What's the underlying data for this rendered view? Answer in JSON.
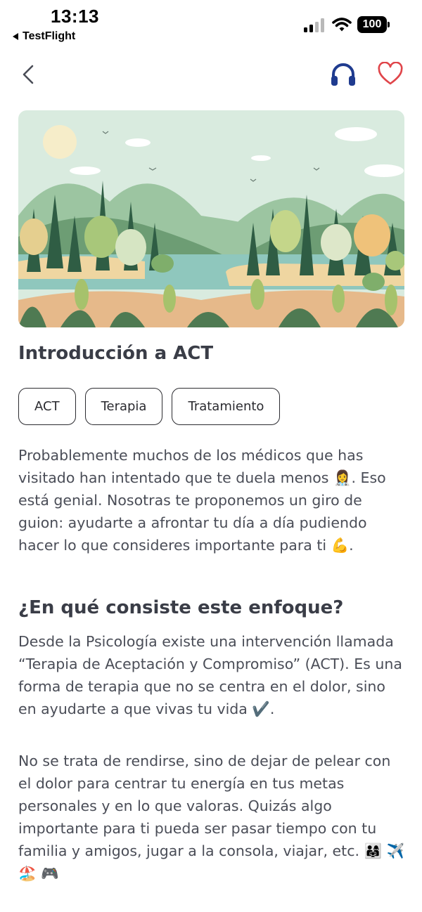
{
  "status_bar": {
    "time": "13:13",
    "back_app": "TestFlight",
    "battery": "100"
  },
  "nav": {
    "back_icon": "chevron-left-icon",
    "audio_icon": "headphones-icon",
    "favorite_icon": "heart-icon"
  },
  "colors": {
    "accent_blue": "#1f3b8f",
    "accent_red": "#e0454a",
    "text_dark": "#3a3d47"
  },
  "article": {
    "title": "Introducción a ACT",
    "tags": [
      "ACT",
      "Terapia",
      "Tratamiento"
    ],
    "intro": "Probablemente muchos de los médicos que has visitado han intentado que te duela menos 👩‍⚕️. Eso está genial. Nosotras te proponemos un giro de guion: ayudarte a afrontar tu día a día pudiendo hacer lo que consideres importante para ti 💪.",
    "section_heading": "¿En qué consiste este enfoque?",
    "section_p1": "Desde la Psicología existe una intervención llamada “Terapia de Aceptación y Compromiso” (ACT). Es una forma de terapia que no se centra en el dolor, sino en ayudarte a que vivas tu vida ✔️.",
    "section_p2": "No se trata de rendirse, sino de dejar de pelear con el dolor para centrar tu energía en tus metas personales y en lo que valoras. Quizás algo importante para ti pueda ser pasar tiempo con tu familia y amigos, jugar a la consola, viajar, etc. 👨‍👩‍👧 ✈️ 🏖️ 🎮"
  }
}
